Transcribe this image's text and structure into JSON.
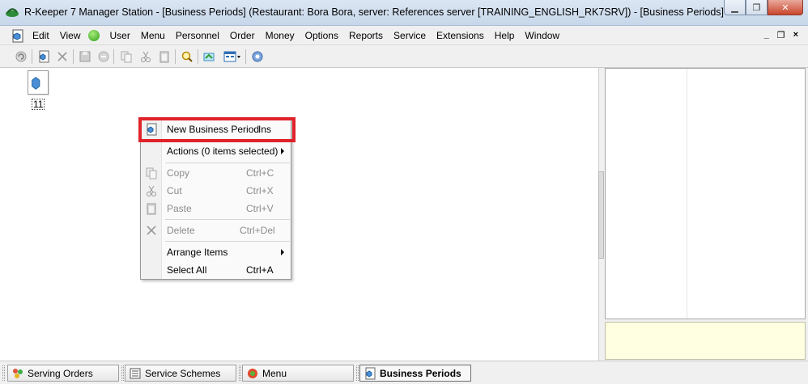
{
  "window": {
    "title": "R-Keeper 7 Manager Station - [Business Periods] (Restaurant: Bora Bora, server: References server [TRAINING_ENGLISH_RK7SRV]) - [Business Periods]",
    "minimize_label": "▁",
    "maximize_label": "❐",
    "close_label": "✕"
  },
  "menubar": {
    "items": [
      {
        "label": "Edit"
      },
      {
        "label": "View"
      },
      {
        "label": "User"
      },
      {
        "label": "Menu"
      },
      {
        "label": "Personnel"
      },
      {
        "label": "Order"
      },
      {
        "label": "Money"
      },
      {
        "label": "Options"
      },
      {
        "label": "Reports"
      },
      {
        "label": "Service"
      },
      {
        "label": "Extensions"
      },
      {
        "label": "Help"
      },
      {
        "label": "Window"
      }
    ],
    "mdi_minimize": "_",
    "mdi_restore": "❐",
    "mdi_close": "×"
  },
  "main": {
    "item_label": "11"
  },
  "context_menu": {
    "items": [
      {
        "label": "New Business Period",
        "shortcut": "Ins"
      },
      {
        "label": "Actions (0 items selected)",
        "shortcut": ""
      },
      {
        "label": "Copy",
        "shortcut": "Ctrl+C"
      },
      {
        "label": "Cut",
        "shortcut": "Ctrl+X"
      },
      {
        "label": "Paste",
        "shortcut": "Ctrl+V"
      },
      {
        "label": "Delete",
        "shortcut": "Ctrl+Del"
      },
      {
        "label": "Arrange Items",
        "shortcut": ""
      },
      {
        "label": "Select All",
        "shortcut": "Ctrl+A"
      }
    ]
  },
  "tabs": [
    {
      "label": "Serving Orders"
    },
    {
      "label": "Service Schemes"
    },
    {
      "label": "Menu"
    },
    {
      "label": "Business Periods"
    }
  ],
  "colors": {
    "highlight": "#e0222a",
    "hint_panel": "#ffffe1"
  }
}
